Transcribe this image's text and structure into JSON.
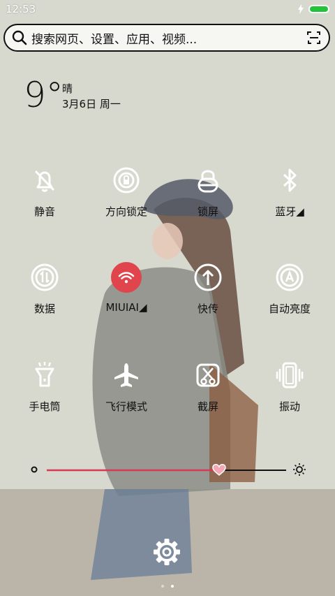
{
  "status_bar": {
    "time": "12:53",
    "icons": [
      "charging-bolt-icon",
      "battery-icon"
    ],
    "battery_color": "#22c33a"
  },
  "search": {
    "placeholder": "搜索网页、设置、应用、视频..."
  },
  "weather": {
    "temperature": "9°",
    "condition": "晴",
    "date": "3月6日 周一"
  },
  "toggles": [
    {
      "label": "静音",
      "icon": "silent-bell-icon",
      "active": false
    },
    {
      "label": "方向锁定",
      "icon": "rotation-lock-icon",
      "active": false
    },
    {
      "label": "锁屏",
      "icon": "lock-icon",
      "active": false
    },
    {
      "label": "蓝牙",
      "icon": "bluetooth-icon",
      "active": false
    },
    {
      "label": "数据",
      "icon": "mobile-data-icon",
      "active": false
    },
    {
      "label": "MIUIAI",
      "icon": "wifi-icon",
      "active": true
    },
    {
      "label": "快传",
      "icon": "quick-transfer-icon",
      "active": false
    },
    {
      "label": "自动亮度",
      "icon": "auto-brightness-icon",
      "active": false
    },
    {
      "label": "手电筒",
      "icon": "flashlight-icon",
      "active": false
    },
    {
      "label": "飞行模式",
      "icon": "airplane-icon",
      "active": false
    },
    {
      "label": "截屏",
      "icon": "screenshot-icon",
      "active": false
    },
    {
      "label": "振动",
      "icon": "vibrate-icon",
      "active": false
    }
  ],
  "brightness": {
    "level": 0.72,
    "accent": "#d63a55",
    "thumb_icon": "heart-icon"
  },
  "pager": {
    "pages": 2,
    "current": 2
  },
  "colors": {
    "active_toggle": "#e0454d"
  }
}
